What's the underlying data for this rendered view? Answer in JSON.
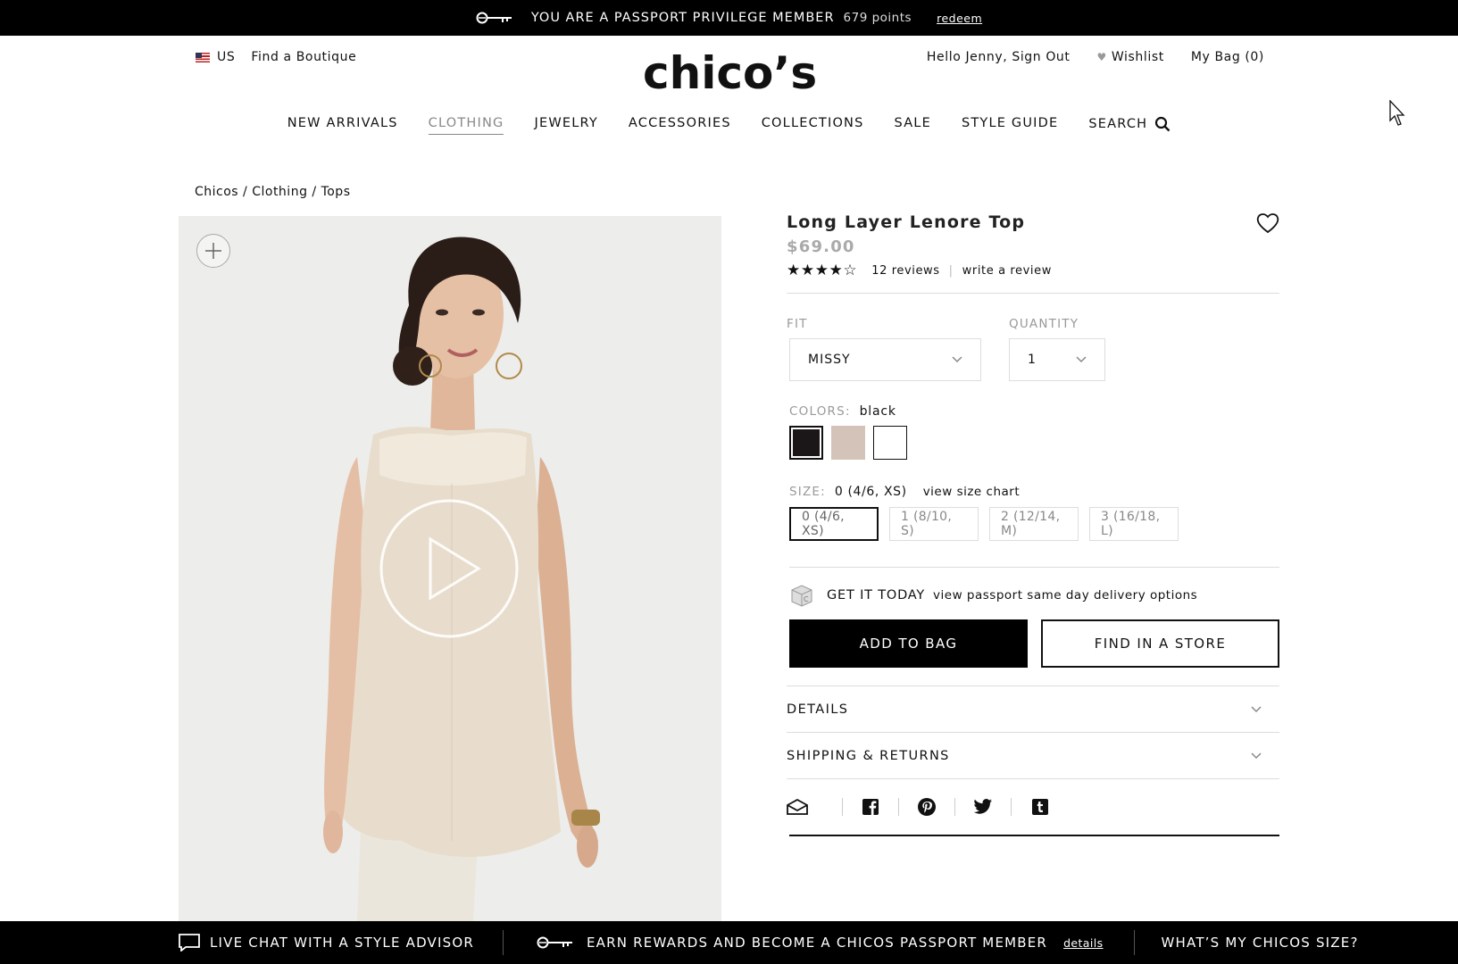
{
  "promo_bar": {
    "member_text": "YOU ARE A PASSPORT PRIVILEGE MEMBER",
    "points": "679 points",
    "redeem_label": "redeem"
  },
  "header": {
    "country": "US",
    "find_boutique": "Find a Boutique",
    "logo": "chico’s",
    "greeting": "Hello Jenny, Sign Out",
    "wishlist": "Wishlist",
    "bag": "My Bag (0)"
  },
  "nav": {
    "items": [
      "NEW ARRIVALS",
      "CLOTHING",
      "JEWELRY",
      "ACCESSORIES",
      "COLLECTIONS",
      "SALE",
      "STYLE GUIDE"
    ],
    "active": "CLOTHING",
    "search": "SEARCH"
  },
  "breadcrumb": "Chicos / Clothing / Tops",
  "product": {
    "title": "Long Layer Lenore Top",
    "price": "$69.00",
    "rating": 4,
    "rating_max": 5,
    "reviews": "12 reviews",
    "write_review": "write a review",
    "fit_label": "FIT",
    "fit_value": "MISSY",
    "quantity_label": "QUANTITY",
    "quantity_value": "1",
    "colors_label": "COLORS:",
    "color_selected": "black",
    "colors": [
      "#1b1719",
      "#d3c3b9",
      "#ffffff"
    ],
    "size_label": "SIZE:",
    "size_selected": "0 (4/6, XS)",
    "size_chart": "view size chart",
    "sizes": [
      "0 (4/6, XS)",
      "1 (8/10, S)",
      "2 (12/14, M)",
      "3 (16/18, L)"
    ],
    "get_it_today": "GET IT TODAY",
    "delivery_link": "view passport same day delivery options",
    "add_to_bag": "ADD TO BAG",
    "find_in_store": "FIND IN A STORE",
    "details": "DETAILS",
    "shipping": "SHIPPING & RETURNS",
    "share_icons": [
      "email-icon",
      "facebook-icon",
      "pinterest-icon",
      "twitter-icon",
      "tumblr-icon"
    ]
  },
  "bottom_bar": {
    "chat": "LIVE CHAT WITH A STYLE ADVISOR",
    "rewards": "EARN REWARDS AND BECOME A CHICOS PASSPORT MEMBER",
    "details_link": "details",
    "size_link": "WHAT’S MY CHICOS SIZE?"
  },
  "colors": {
    "bar_bg": "#000000",
    "image_bg": "#ededeb",
    "muted": "#999999"
  }
}
